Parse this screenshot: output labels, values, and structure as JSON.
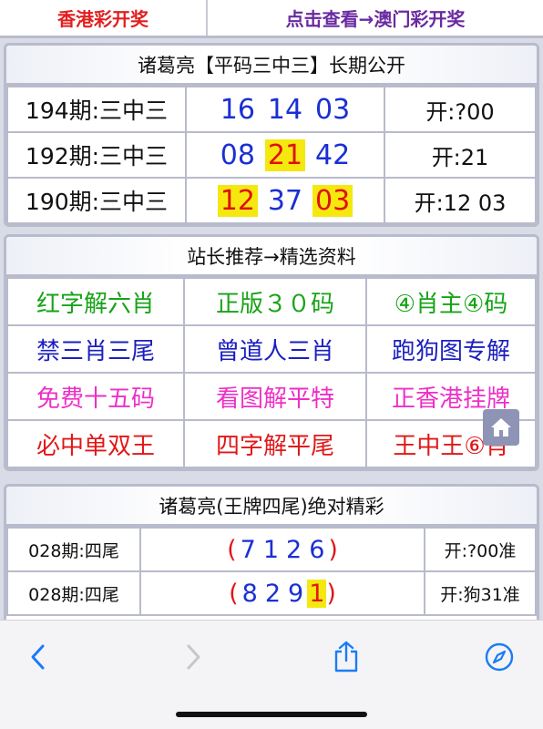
{
  "nav": {
    "hk_label": "香港彩开奖",
    "macau_label": "点击查看→澳门彩开奖"
  },
  "pingma": {
    "title": "诸葛亮【平码三中三】长期公开",
    "rows": [
      {
        "issue": "194期:三中三",
        "numbers": [
          {
            "n": "16",
            "hit": false
          },
          {
            "n": "14",
            "hit": false
          },
          {
            "n": "03",
            "hit": false
          }
        ],
        "result": "开:?00"
      },
      {
        "issue": "192期:三中三",
        "numbers": [
          {
            "n": "08",
            "hit": false
          },
          {
            "n": "21",
            "hit": true
          },
          {
            "n": "42",
            "hit": false
          }
        ],
        "result": "开:21"
      },
      {
        "issue": "190期:三中三",
        "numbers": [
          {
            "n": "12",
            "hit": true
          },
          {
            "n": "37",
            "hit": false
          },
          {
            "n": "03",
            "hit": true
          }
        ],
        "result": "开:12 03"
      }
    ]
  },
  "picks": {
    "title": "站长推荐→精选资料",
    "rows": [
      [
        {
          "label": "红字解六肖",
          "color": "green"
        },
        {
          "label": "正版３０码",
          "color": "green"
        },
        {
          "label": "④肖主④码",
          "color": "green"
        }
      ],
      [
        {
          "label": "禁三肖三尾",
          "color": "blue"
        },
        {
          "label": "曾道人三肖",
          "color": "blue"
        },
        {
          "label": "跑狗图专解",
          "color": "blue"
        }
      ],
      [
        {
          "label": "免费十五码",
          "color": "pink"
        },
        {
          "label": "看图解平特",
          "color": "pink"
        },
        {
          "label": "正香港挂牌",
          "color": "pink"
        }
      ],
      [
        {
          "label": "必中单双王",
          "color": "red"
        },
        {
          "label": "四字解平尾",
          "color": "red"
        },
        {
          "label": "王中王⑥肖",
          "color": "red"
        }
      ]
    ]
  },
  "tails": {
    "title": "诸葛亮(王牌四尾)绝对精彩",
    "open_paren": "(",
    "close_paren": ")",
    "rows": [
      {
        "issue": "028期:四尾",
        "digits": [
          {
            "d": "7",
            "hit": false
          },
          {
            "d": "1",
            "hit": false
          },
          {
            "d": "2",
            "hit": false
          },
          {
            "d": "6",
            "hit": false
          }
        ],
        "result": "开:?00准"
      },
      {
        "issue": "028期:四尾",
        "digits": [
          {
            "d": "8",
            "hit": false
          },
          {
            "d": "2",
            "hit": false
          },
          {
            "d": "9",
            "hit": false
          },
          {
            "d": "1",
            "hit": true
          }
        ],
        "result": "开:狗31准"
      }
    ]
  },
  "browser": {
    "back_icon": "chevron-left-icon",
    "forward_icon": "chevron-right-icon",
    "share_icon": "share-icon",
    "compass_icon": "compass-icon",
    "accent": "#1a7cf5"
  },
  "colors": {
    "green": "#17a317",
    "blue": "#1b1fbf",
    "pink": "#ee2fc7",
    "red": "#e01818",
    "highlight": "#f5e80f"
  }
}
